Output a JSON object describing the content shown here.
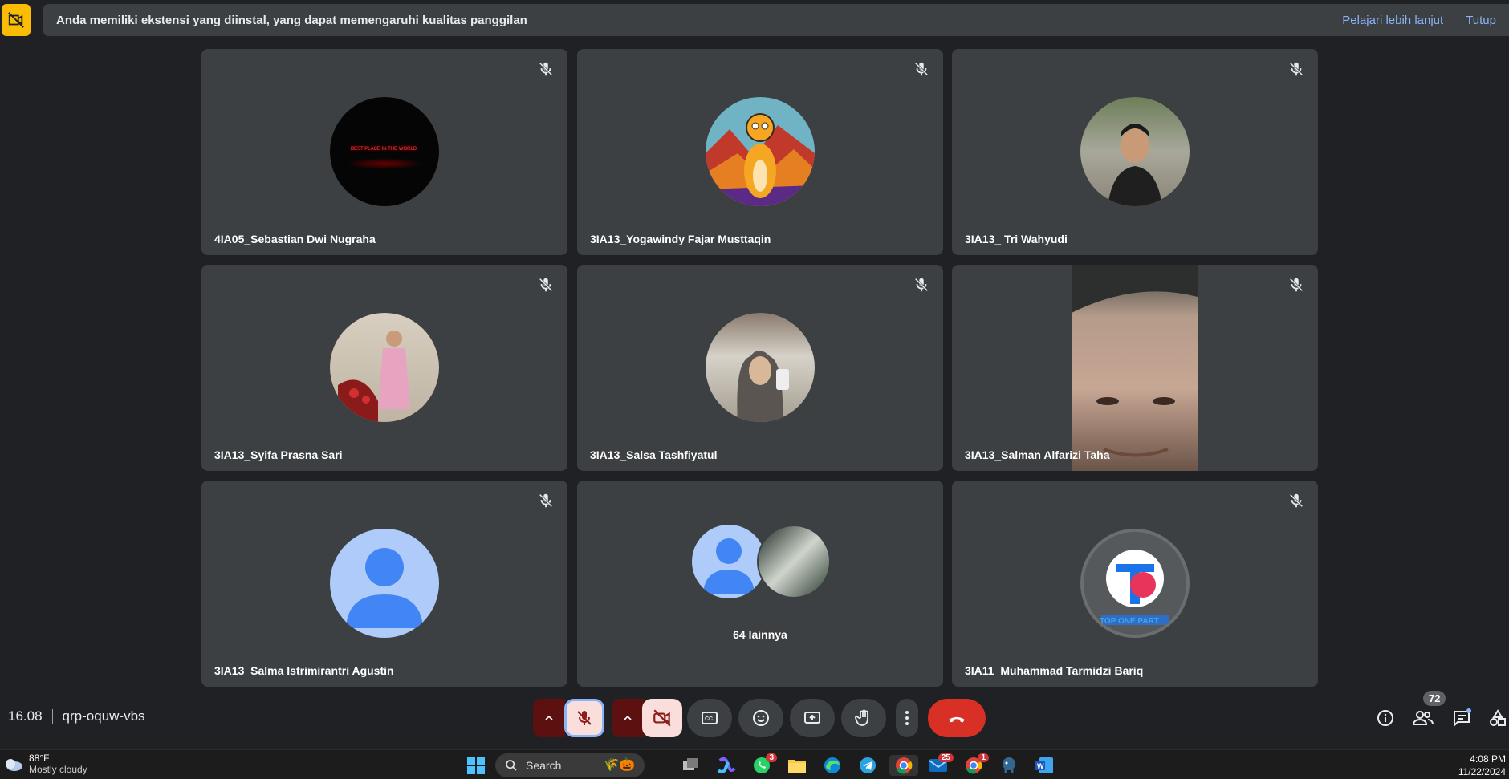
{
  "banner": {
    "message": "Anda memiliki ekstensi yang diinstal, yang dapat memengaruhi kualitas panggilan",
    "learn_more": "Pelajari lebih lanjut",
    "close": "Tutup"
  },
  "participants": [
    {
      "name": "4IA05_Sebastian Dwi Nugraha",
      "muted": true,
      "avatar_overlay": "BEST PLACE IN THE WORLD"
    },
    {
      "name": "3IA13_Yogawindy Fajar Musttaqin",
      "muted": true
    },
    {
      "name": "3IA13_ Tri Wahyudi",
      "muted": true
    },
    {
      "name": "3IA13_Syifa Prasna Sari",
      "muted": true
    },
    {
      "name": "3IA13_Salsa Tashfiyatul",
      "muted": true
    },
    {
      "name": "3IA13_Salman Alfarizi Taha",
      "muted": true
    },
    {
      "name": "3IA13_Salma Istrimirantri Agustin",
      "muted": true
    },
    {
      "name": "",
      "others_label": "64 lainnya"
    },
    {
      "name": "3IA11_Muhammad Tarmidzi Bariq",
      "muted": true,
      "avatar_overlay": "TOP ONE PART"
    }
  ],
  "meeting": {
    "time": "16.08",
    "code": "qrp-oquw-vbs",
    "participant_count": "72"
  },
  "taskbar": {
    "weather_temp": "88°F",
    "weather_desc": "Mostly cloudy",
    "search_label": "Search",
    "whatsapp_badge": "3",
    "mail_badge": "25",
    "chrome2_badge": "1",
    "clock_time": "4:08 PM",
    "clock_date": "11/22/2024"
  },
  "colors": {
    "background": "#202124",
    "tile": "#3c4043",
    "end_call": "#d93025",
    "accent_blue": "#8ab4f8",
    "warning_yellow": "#fbbc04"
  }
}
